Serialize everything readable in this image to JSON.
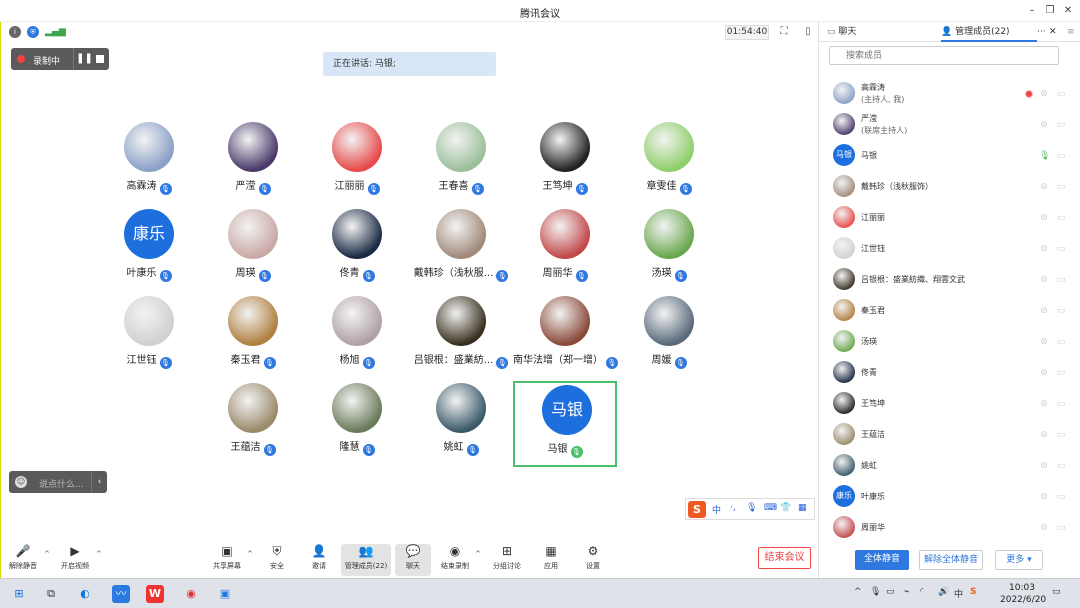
{
  "window": {
    "title": "腾讯会议"
  },
  "infobar": {
    "timer": "01:54:40"
  },
  "recording": {
    "label": "录制中"
  },
  "speaking": {
    "text": "正在讲话: 马银;"
  },
  "participants": [
    {
      "name": "高霖涛",
      "color": "#8aa0c8"
    },
    {
      "name": "严滢",
      "color": "#4a3a6a"
    },
    {
      "name": "江丽丽",
      "color": "#e84a4a"
    },
    {
      "name": "王春喜",
      "color": "#9bbf9b"
    },
    {
      "name": "王笃坤",
      "color": "#222222"
    },
    {
      "name": "章雯佳",
      "color": "#8fcf6a"
    },
    {
      "name": "叶康乐",
      "initials": "康乐",
      "color": "#1e6fde"
    },
    {
      "name": "周瑛",
      "color": "#c9a9a6"
    },
    {
      "name": "佟青",
      "color": "#1a2a44"
    },
    {
      "name": "戴韩珍（浅秋服...",
      "color": "#a08a7a"
    },
    {
      "name": "周丽华",
      "color": "#c2484a"
    },
    {
      "name": "汤瑛",
      "color": "#6aa84f"
    },
    {
      "name": "江世钰",
      "color": "#d0d0d0"
    },
    {
      "name": "秦玉君",
      "color": "#b08040"
    },
    {
      "name": "杨旭",
      "color": "#b0a0a8"
    },
    {
      "name": "吕银根：盛業紡...",
      "color": "#3a3020"
    },
    {
      "name": "南华法增（郑一增）",
      "color": "#8a4a3a"
    },
    {
      "name": "周媛",
      "color": "#5a6a7a"
    },
    {
      "name": "王蕴洁",
      "color": "#9a8a6a"
    },
    {
      "name": "隆慧",
      "color": "#6a7a5a"
    },
    {
      "name": "姚虹",
      "color": "#3a5a6a"
    },
    {
      "name": "马银",
      "initials": "马银",
      "color": "#1e6fde"
    }
  ],
  "chat": {
    "placeholder": "说点什么..."
  },
  "ime": {
    "label": "中",
    "extra": "·,",
    "keys": "⌨"
  },
  "toolbar": {
    "unmute": "解除静音",
    "video": "开启视频",
    "share": "共享屏幕",
    "security": "安全",
    "invite": "邀请",
    "members": "管理成员(22)",
    "chat": "聊天",
    "end_record": "结束录制",
    "breakout": "分组讨论",
    "apps": "应用",
    "settings": "设置",
    "end_meeting": "结束会议"
  },
  "panel": {
    "tab_chat": "聊天",
    "tab_members": "管理成员(22)",
    "search_placeholder": "搜索成员",
    "members": [
      {
        "name": "高霖涛",
        "sub": "(主持人, 我)",
        "color": "#8aa0c8"
      },
      {
        "name": "严滢",
        "sub": "(联席主持人)",
        "color": "#4a3a6a"
      },
      {
        "name": "马银",
        "initials": "马银",
        "color": "#1e6fde"
      },
      {
        "name": "戴韩珍（浅秋服饰）",
        "color": "#a08a7a"
      },
      {
        "name": "江丽丽",
        "color": "#e84a4a"
      },
      {
        "name": "江世钰",
        "color": "#d0d0d0"
      },
      {
        "name": "吕银根：盛業紡織、翔雲文武",
        "color": "#3a3020"
      },
      {
        "name": "秦玉君",
        "color": "#b08040"
      },
      {
        "name": "汤瑛",
        "color": "#6aa84f"
      },
      {
        "name": "佟青",
        "color": "#1a2a44"
      },
      {
        "name": "王笃坤",
        "color": "#222222"
      },
      {
        "name": "王蕴洁",
        "color": "#9a8a6a"
      },
      {
        "name": "姚虹",
        "color": "#3a5a6a"
      },
      {
        "name": "叶康乐",
        "initials": "康乐",
        "color": "#1e6fde"
      },
      {
        "name": "周丽华",
        "color": "#c2484a"
      }
    ],
    "mute_all": "全体静音",
    "unmute_all": "解除全体静音",
    "more": "更多"
  },
  "taskbar": {
    "time": "10:03",
    "date": "2022/6/20",
    "ime": "中"
  },
  "colors": {
    "accent": "#2f78e0",
    "danger": "#e44444",
    "active": "#4cbf6a"
  }
}
